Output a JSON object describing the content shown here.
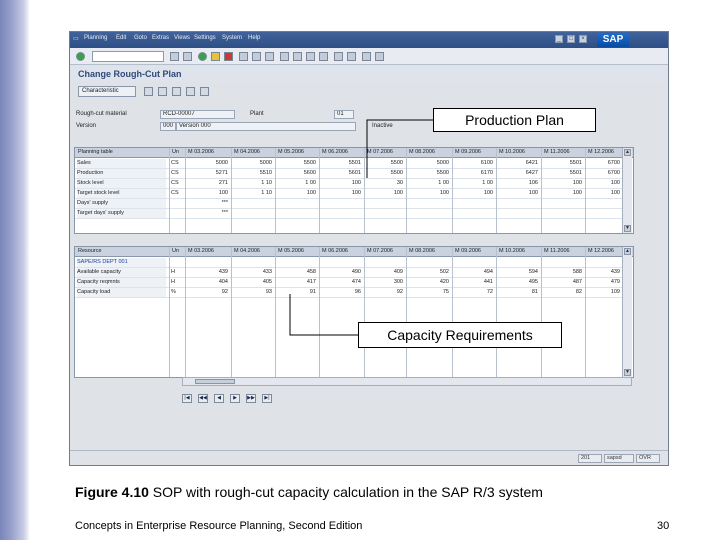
{
  "sap": {
    "menu": [
      "Planning",
      "Edit",
      "Goto",
      "Extras",
      "Views",
      "Settings",
      "System",
      "Help"
    ],
    "logo": "SAP",
    "screen_title": "Change Rough-Cut Plan",
    "app_button": "Characteristic",
    "fields": {
      "material_label": "Rough-cut material",
      "material_value": "RCD-00007",
      "plant_label": "Plant",
      "plant_value": "01",
      "version_label": "Version",
      "version_value": "000",
      "version_desc": "Version 000",
      "status_text": "Inactive"
    },
    "table1": {
      "headers": [
        "Planning table",
        "Un",
        "M 03.2006",
        "M 04.2006",
        "M 05.2006",
        "M 06.2006",
        "M 07.2006",
        "M 08.2006",
        "M 09.2006",
        "M 10.2006",
        "M 11.2006",
        "M 12.2006"
      ],
      "rows": [
        [
          "Sales",
          "CS",
          "5000",
          "5000",
          "5500",
          "5501",
          "5500",
          "5000",
          "6100",
          "6421",
          "5501",
          "6700"
        ],
        [
          "Production",
          "CS",
          "5271",
          "5510",
          "5600",
          "5601",
          "5500",
          "5500",
          "6170",
          "6427",
          "5501",
          "6700"
        ],
        [
          "Stock level",
          "CS",
          "271",
          "1 10",
          "1 00",
          "100",
          "30",
          "1 00",
          "1 00",
          "106",
          "100",
          "100"
        ],
        [
          "Target stock level",
          "CS",
          "100",
          "1 10",
          "100",
          "100",
          "100",
          "100",
          "100",
          "100",
          "100",
          "100"
        ],
        [
          "Days' supply",
          "",
          "***",
          "",
          "",
          "",
          "",
          "",
          "",
          "",
          "",
          ""
        ],
        [
          "Target days' supply",
          "",
          "***",
          "",
          "",
          "",
          "",
          "",
          "",
          "",
          "",
          ""
        ]
      ]
    },
    "table2": {
      "headers": [
        "Resource",
        "Un",
        "M 03.2006",
        "M 04.2006",
        "M 05.2006",
        "M 06.2006",
        "M 07.2006",
        "M 08.2006",
        "M 09.2006",
        "M 10.2006",
        "M 11.2006",
        "M 12.2006"
      ],
      "rows": [
        [
          "SAPE/RS DEPT 001",
          "",
          "",
          "",
          "",
          "",
          "",
          "",
          "",
          "",
          "",
          ""
        ],
        [
          "Available capacity",
          "H",
          "439",
          "433",
          "458",
          "490",
          "409",
          "502",
          "494",
          "594",
          "588",
          "439"
        ],
        [
          "Capacity reqmnts",
          "H",
          "404",
          "405",
          "417",
          "474",
          "300",
          "420",
          "441",
          "495",
          "487",
          "479"
        ],
        [
          "Capacity load",
          "%",
          "92",
          "93",
          "91",
          "96",
          "92",
          "75",
          "72",
          "81",
          "82",
          "109"
        ]
      ]
    },
    "status": [
      "201",
      "sapsd",
      "OVR"
    ]
  },
  "callouts": {
    "production_plan": "Production Plan",
    "capacity_requirements": "Capacity Requirements"
  },
  "caption": {
    "prefix": "Figure 4.10",
    "text": " SOP with rough-cut capacity calculation in the SAP R/3 system"
  },
  "footer": {
    "left": "Concepts in Enterprise Resource Planning, Second Edition",
    "page": "30"
  }
}
